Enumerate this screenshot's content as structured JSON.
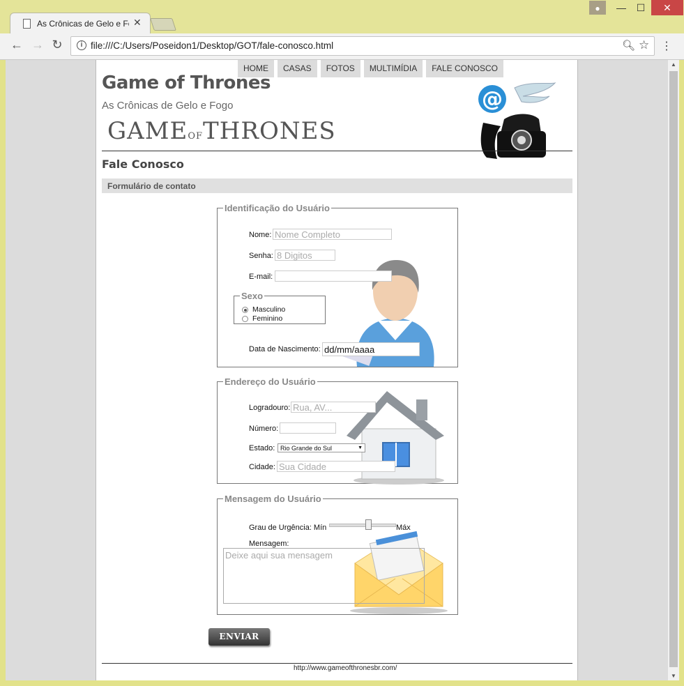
{
  "browser": {
    "tab_title": "As Crônicas de Gelo e Fo",
    "url": "file:///C:/Users/Poseidon1/Desktop/GOT/fale-conosco.html"
  },
  "nav": {
    "items": [
      "HOME",
      "CASAS",
      "FOTOS",
      "MULTIMÍDIA",
      "FALE CONOSCO"
    ]
  },
  "header": {
    "title": "Game of Thrones",
    "subtitle": "As Crônicas de Gelo e Fogo",
    "logo_left": "GAME",
    "logo_mid": "OF",
    "logo_right": "THRONES"
  },
  "main": {
    "section_title": "Fale Conosco",
    "section_bar": "Formulário de contato"
  },
  "identificacao": {
    "legend": "Identificação do Usuário",
    "nome_label": "Nome:",
    "nome_placeholder": "Nome Completo",
    "senha_label": "Senha:",
    "senha_placeholder": "8 Digitos",
    "email_label": "E-mail:",
    "sexo_legend": "Sexo",
    "sexo_options": [
      "Masculino",
      "Feminino"
    ],
    "sexo_selected": "Masculino",
    "nascimento_label": "Data de Nascimento:",
    "nascimento_value": "dd/mm/aaaa"
  },
  "endereco": {
    "legend": "Endereço do Usuário",
    "logradouro_label": "Logradouro:",
    "logradouro_placeholder": "Rua, AV...",
    "numero_label": "Número:",
    "estado_label": "Estado:",
    "estado_value": "Rio Grande do Sul",
    "cidade_label": "Cidade:",
    "cidade_placeholder": "Sua Cidade"
  },
  "mensagem": {
    "legend": "Mensagem do Usuário",
    "urgencia_label": "Grau de Urgência: Mín",
    "urgencia_max": "Máx",
    "urgencia_level": 0.6,
    "mensagem_label": "Mensagem:",
    "mensagem_placeholder": "Deixe aqui sua mensagem"
  },
  "form": {
    "submit_label": "ENVIAR"
  },
  "footer": {
    "url": "http://www.gameofthronesbr.com/"
  }
}
